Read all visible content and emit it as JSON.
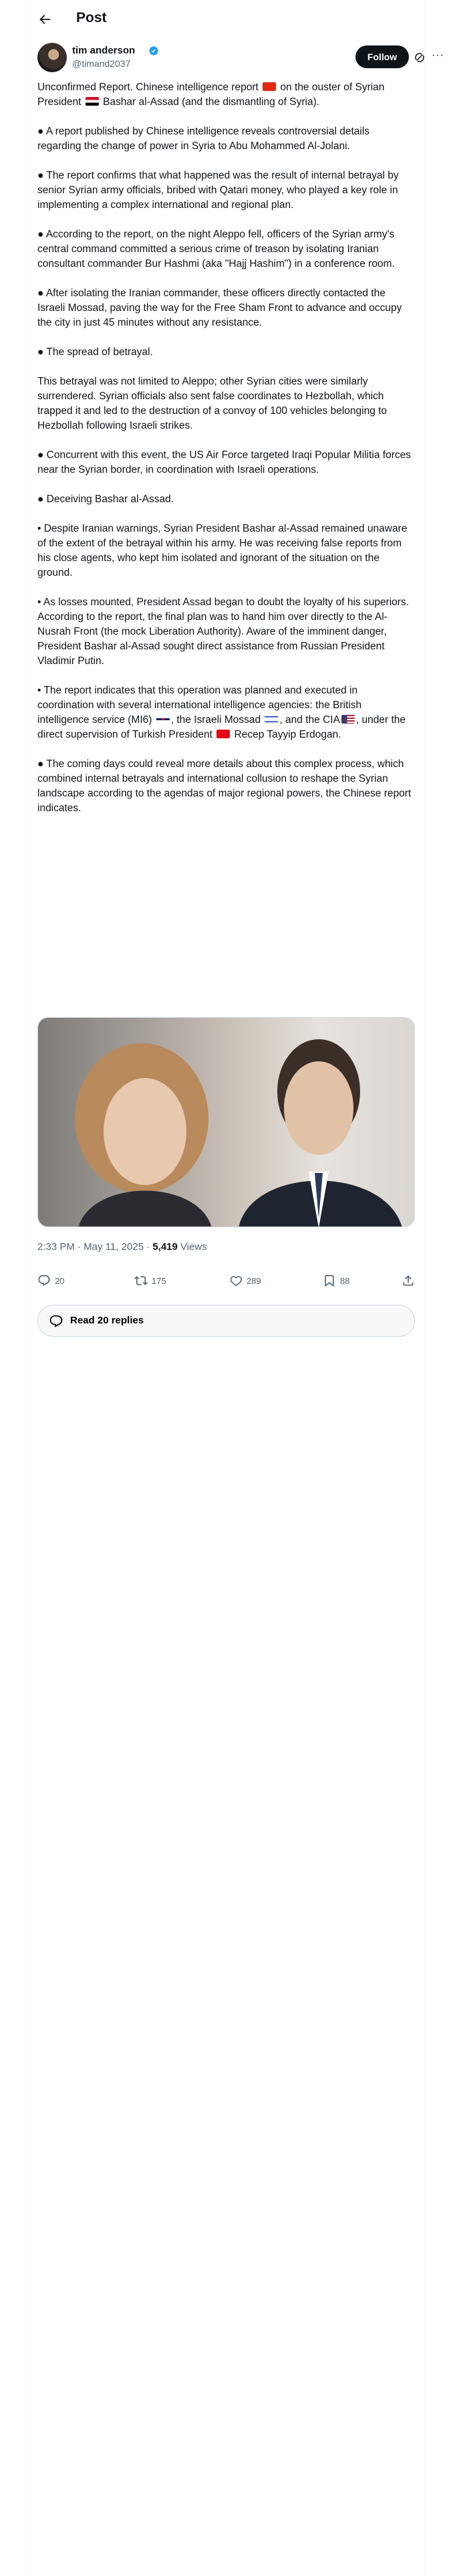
{
  "header": {
    "title": "Post"
  },
  "author": {
    "name": "tim anderson",
    "handle": "@timand2037",
    "follow_label": "Follow"
  },
  "post": {
    "paragraphs": [
      {
        "parts": [
          "Unconfirmed Report. Chinese intelligence report ",
          " on the ouster of Syrian President ",
          " Bashar al-Assad (and the dismantling of Syria)."
        ]
      },
      {
        "text": "● A report published by Chinese intelligence reveals controversial details regarding the change of power in Syria to Abu Mohammed Al-Jolani."
      },
      {
        "text": "● The report confirms that what happened was the result of internal betrayal by senior Syrian army officials, bribed with Qatari money, who played a key role in implementing a complex international and regional plan."
      },
      {
        "text": "● According to the report, on the night Aleppo fell, officers of the Syrian army's central command committed a serious crime of treason by isolating Iranian consultant commander Bur Hashmi (aka \"Hajj Hashim\") in a conference room."
      },
      {
        "text": "● After isolating the Iranian commander, these officers directly contacted the Israeli Mossad, paving the way for the Free Sham Front to advance and occupy the city in just 45 minutes without any resistance."
      },
      {
        "text": "● The spread of betrayal."
      },
      {
        "text": "This betrayal was not limited to Aleppo; other Syrian cities were similarly surrendered. Syrian officials also sent false coordinates to Hezbollah, which trapped it and led to the destruction of a convoy of 100 vehicles belonging to Hezbollah following Israeli strikes."
      },
      {
        "text": "● Concurrent with this event, the US Air Force targeted Iraqi Popular Militia forces near the Syrian border, in coordination with Israeli operations."
      },
      {
        "text": "● Deceiving Bashar al-Assad."
      },
      {
        "text": "• Despite Iranian warnings, Syrian President Bashar al-Assad remained unaware of the extent of the betrayal within his army. He was receiving false reports from his close agents, who kept him isolated and ignorant of the situation on the ground."
      },
      {
        "text": "• As losses mounted, President Assad began to doubt the loyalty of his superiors. According to the report, the final plan was to hand him over directly to the Al-Nusrah Front (the mock Liberation Authority). Aware of the imminent danger, President Bashar al-Assad sought direct assistance from Russian President Vladimir Putin."
      },
      {
        "parts": [
          "• The report indicates that this operation was planned and executed in coordination with several international intelligence agencies: the British intelligence service (MI6) ",
          ", the Israeli Mossad ",
          ", and the CIA",
          ", under the direct supervision of Turkish President ",
          " Recep Tayyip Erdogan."
        ]
      },
      {
        "text": "● The coming days could reveal more details about this complex process, which combined internal betrayals and international collusion to reshape the Syrian landscape according to the agendas of major regional powers, the Chinese report indicates."
      }
    ]
  },
  "meta": {
    "time": "2:33 PM · May 11, 2025 · ",
    "views_count": "5,419",
    "views_label": " Views"
  },
  "actions": {
    "replies": "20",
    "reposts": "175",
    "likes": "289",
    "bookmarks": "88"
  },
  "read_replies_label": "Read 20 replies",
  "icons": [
    "back-arrow-icon",
    "verified-badge-icon",
    "grok-icon",
    "more-icon",
    "reply-icon",
    "repost-icon",
    "like-icon",
    "bookmark-icon",
    "share-icon",
    "replies-bubble-icon"
  ],
  "colors": {
    "accent": "#1d9bf0",
    "text": "#0f1419",
    "muted": "#536471",
    "border": "#cfd9de"
  }
}
